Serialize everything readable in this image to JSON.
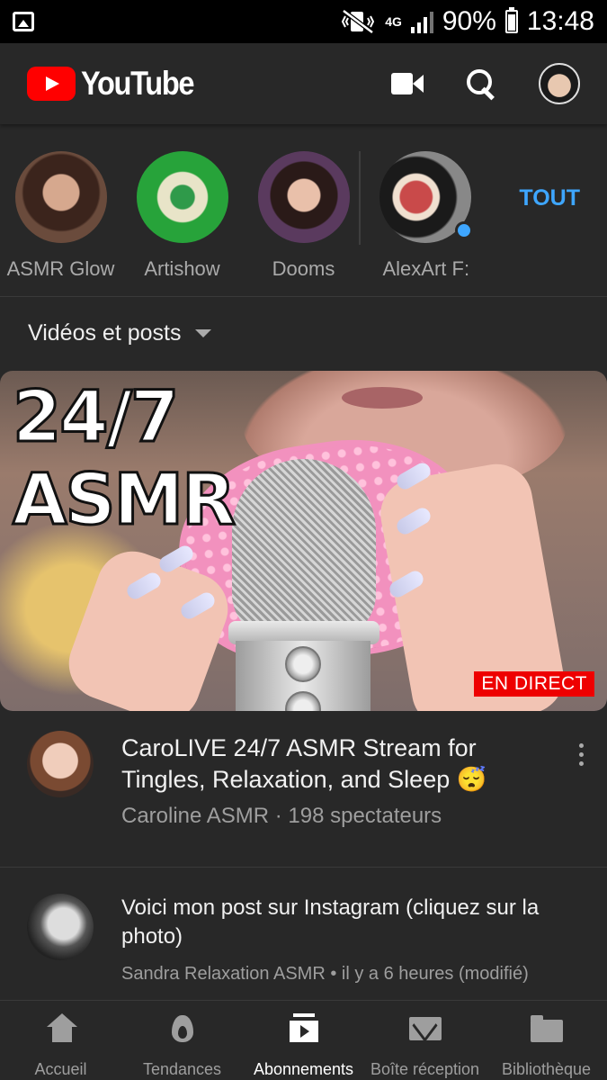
{
  "status_bar": {
    "battery": "90%",
    "time": "13:48",
    "network": "4G"
  },
  "app_bar": {
    "logo_text": "YouTube",
    "colors": {
      "brand_red": "#ff0000",
      "accent_blue": "#3ea6ff"
    }
  },
  "channels": {
    "items": [
      {
        "label": "ASMR Glow"
      },
      {
        "label": "Artishow"
      },
      {
        "label": "Dooms"
      },
      {
        "label": "AlexArt F:"
      }
    ],
    "all_label": "TOUT"
  },
  "filter": {
    "label": "Vidéos et posts"
  },
  "video": {
    "thumbnail_text_line1": "24/7",
    "thumbnail_text_line2": "ASMR",
    "live_badge": "EN DIRECT",
    "title": "CaroLIVE 24/7 ASMR Stream for Tingles, Relaxation, and Sleep 😴",
    "meta": "Caroline ASMR · 198 spectateurs"
  },
  "post": {
    "title": "Voici mon post sur Instagram (cliquez sur la photo)",
    "meta": "Sandra Relaxation ASMR • il y a 6 heures (modifié)"
  },
  "bottom_nav": {
    "items": [
      {
        "label": "Accueil",
        "icon": "home-icon"
      },
      {
        "label": "Tendances",
        "icon": "fire-icon"
      },
      {
        "label": "Abonnements",
        "icon": "subscriptions-icon"
      },
      {
        "label": "Boîte réception",
        "icon": "mail-icon"
      },
      {
        "label": "Bibliothèque",
        "icon": "folder-icon"
      }
    ],
    "active_index": 2
  }
}
